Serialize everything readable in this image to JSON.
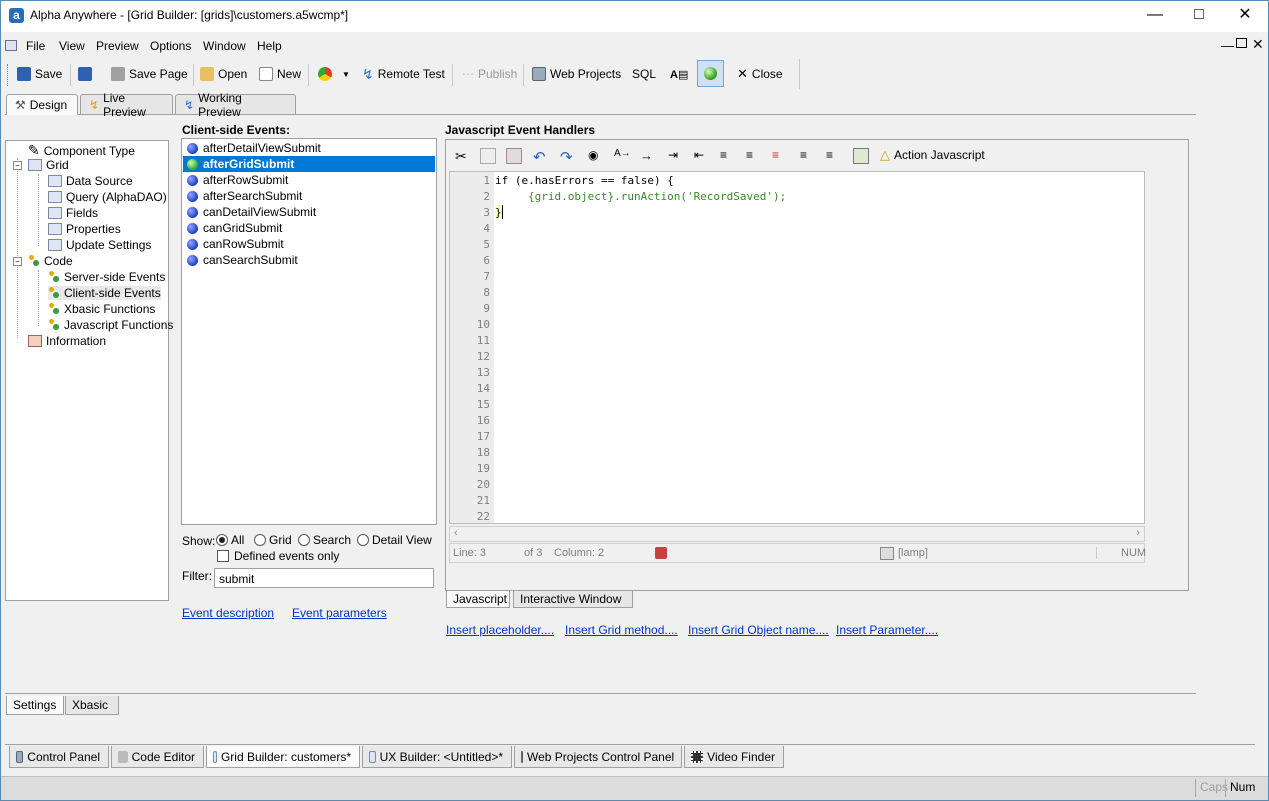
{
  "window": {
    "title": "Alpha Anywhere - [Grid Builder: [grids]\\customers.a5wcmp*]"
  },
  "menu": [
    "File",
    "View",
    "Preview",
    "Options",
    "Window",
    "Help"
  ],
  "toolbar": {
    "save": "Save",
    "save_page": "Save Page",
    "open": "Open",
    "new": "New",
    "remote_test": "Remote Test",
    "publish": "Publish",
    "web_projects": "Web Projects",
    "sql": "SQL",
    "close": "Close"
  },
  "design_tabs": [
    "Design",
    "Live Preview",
    "Working Preview"
  ],
  "tree": {
    "component_type": "Component Type",
    "grid": "Grid",
    "data_source": "Data Source",
    "query": "Query (AlphaDAO)",
    "fields": "Fields",
    "properties": "Properties",
    "update_settings": "Update Settings",
    "code": "Code",
    "server_events": "Server-side Events",
    "client_events": "Client-side Events",
    "xbasic_functions": "Xbasic Functions",
    "js_functions": "Javascript Functions",
    "information": "Information"
  },
  "events": {
    "title": "Client-side Events:",
    "items": [
      "afterDetailViewSubmit",
      "afterGridSubmit",
      "afterRowSubmit",
      "afterSearchSubmit",
      "canDetailViewSubmit",
      "canGridSubmit",
      "canRowSubmit",
      "canSearchSubmit"
    ],
    "selected": "afterGridSubmit"
  },
  "filter": {
    "show_label": "Show:",
    "options": [
      "All",
      "Grid",
      "Search",
      "Detail View"
    ],
    "selected": "All",
    "defined_only": "Defined events only",
    "filter_label": "Filter:",
    "filter_value": "submit"
  },
  "links": {
    "event_description": "Event description",
    "event_parameters": "Event parameters"
  },
  "editor": {
    "title": "Javascript Event Handlers",
    "action_js": "Action Javascript",
    "line_numbers": [
      "1",
      "2",
      "3",
      "4",
      "5",
      "6",
      "7",
      "8",
      "9",
      "10",
      "11",
      "12",
      "13",
      "14",
      "15",
      "16",
      "17",
      "18",
      "19",
      "20",
      "21",
      "22"
    ],
    "code_line1": "if (e.hasErrors == false) {",
    "code_line2": "{grid.object}.runAction('RecordSaved');",
    "code_line3": "}",
    "status_line": "Line: 3",
    "status_of": "of 3",
    "status_col": "Column: 2",
    "status_lamp": "[lamp]",
    "status_num": "NUM"
  },
  "editor_tabs": [
    "Javascript",
    "Interactive Window"
  ],
  "insert_links": [
    "Insert placeholder....",
    "Insert Grid method....",
    "Insert Grid Object name....",
    "Insert Parameter...."
  ],
  "settings_tabs": [
    "Settings",
    "Xbasic"
  ],
  "window_tabs": [
    "Control Panel",
    "Code Editor",
    "Grid Builder: customers*",
    "UX Builder: <Untitled>*",
    "Web Projects Control Panel",
    "Video Finder"
  ],
  "statusbar": {
    "caps": "Caps",
    "num": "Num"
  },
  "colors": {
    "selection": "#0078d7",
    "link": "#0033cc",
    "code_green": "#3a8a2a"
  }
}
